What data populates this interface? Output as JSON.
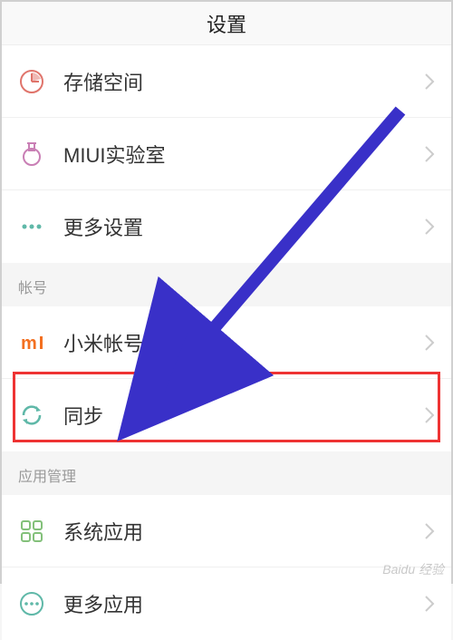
{
  "header": {
    "title": "设置"
  },
  "groups": [
    {
      "items": [
        {
          "id": "storage",
          "label": "存储空间",
          "iconColor": "#e0746b"
        },
        {
          "id": "miui-lab",
          "label": "MIUI实验室",
          "iconColor": "#c97fb5"
        },
        {
          "id": "more-settings",
          "label": "更多设置",
          "iconColor": "#5fb8a8"
        }
      ]
    },
    {
      "header": "帐号",
      "items": [
        {
          "id": "mi-account",
          "label": "小米帐号",
          "iconColor": "#f37021"
        },
        {
          "id": "sync",
          "label": "同步",
          "iconColor": "#5fb8a8",
          "highlighted": true
        }
      ]
    },
    {
      "header": "应用管理",
      "items": [
        {
          "id": "system-apps",
          "label": "系统应用",
          "iconColor": "#83c07a"
        },
        {
          "id": "more-apps",
          "label": "更多应用",
          "iconColor": "#5fb8a8"
        }
      ]
    }
  ],
  "overlay": {
    "arrowColor": "#3930c8",
    "highlightColor": "#e33"
  },
  "watermark": "Baidu 经验"
}
